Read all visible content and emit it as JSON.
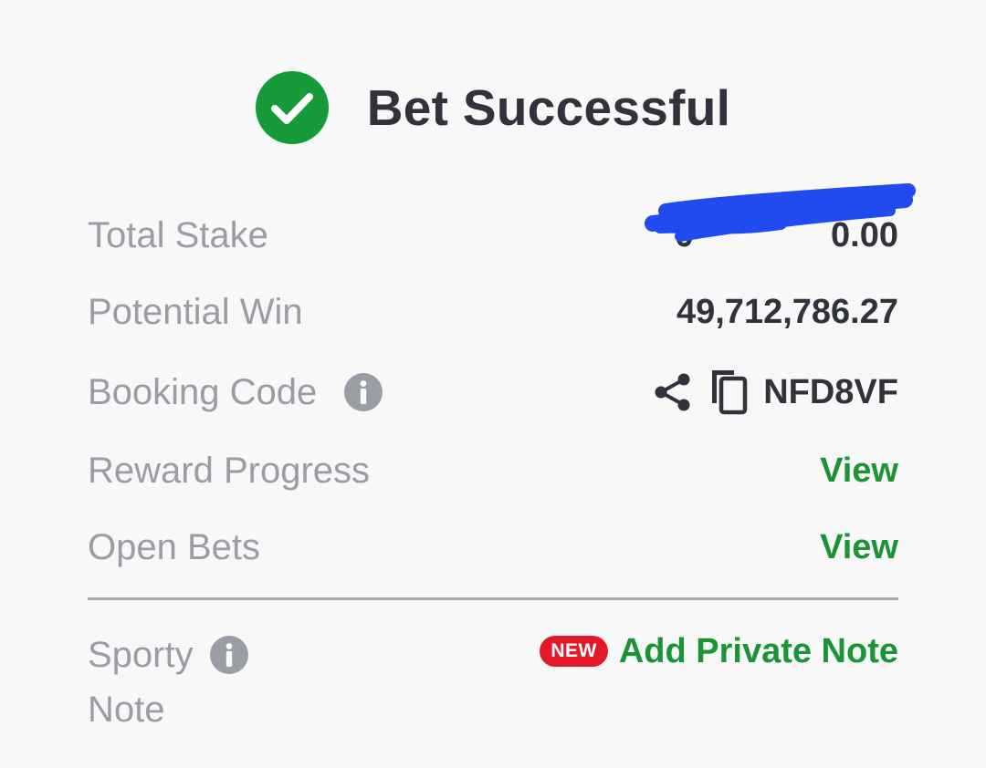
{
  "header": {
    "title": "Bet Successful",
    "icon": "check-circle-icon",
    "icon_color": "#169a3a"
  },
  "rows": {
    "total_stake": {
      "label": "Total Stake",
      "value": "0.00",
      "note": "value obscured by blue scribble"
    },
    "potential_win": {
      "label": "Potential Win",
      "value": "49,712,786.27"
    },
    "booking_code": {
      "label": "Booking Code",
      "value": "NFD8VF",
      "icons": [
        "info-icon",
        "share-icon",
        "copy-icon"
      ]
    },
    "reward_progress": {
      "label": "Reward Progress",
      "link": "View"
    },
    "open_bets": {
      "label": "Open Bets",
      "link": "View"
    }
  },
  "note": {
    "label_line1": "Sporty",
    "label_line2": "Note",
    "badge": "NEW",
    "action": "Add Private Note"
  },
  "colors": {
    "background": "#f8f8f9",
    "text_dark": "#30333b",
    "text_muted": "#9a9da5",
    "link_green": "#1a9434",
    "badge_red": "#e41827",
    "scribble_blue": "#1f4bf0"
  }
}
